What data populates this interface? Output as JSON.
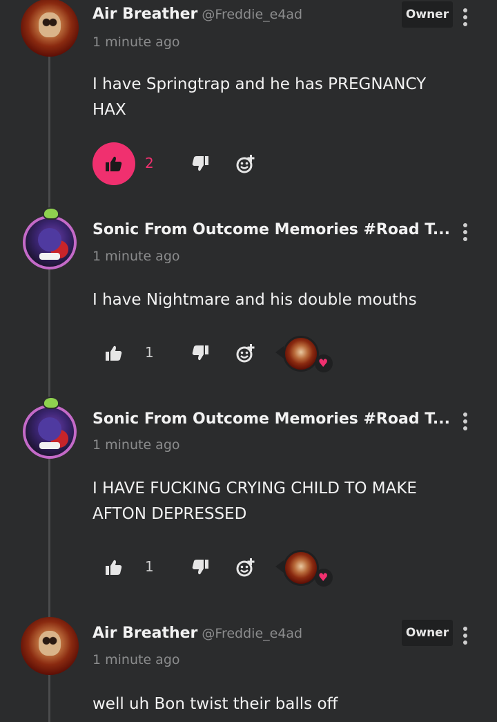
{
  "colors": {
    "background": "#2b2c2d",
    "accent": "#f0306f",
    "muted": "#8b8c8d"
  },
  "comments": [
    {
      "author": "Air Breather",
      "handle": "@Freddie_e4ad",
      "badge": "Owner",
      "time": "1 minute ago",
      "text": "I have Springtrap and he has PREGNANCY HAX",
      "likes": "2",
      "liked": true,
      "avatar": "skull-avatar"
    },
    {
      "author": "Sonic From Outcome Memories #Road T...",
      "time": "1 minute ago",
      "text": "I have Nightmare and his double mouths",
      "likes": "1",
      "liked": false,
      "avatar": "sonic-avatar",
      "reaction": "heart-icon"
    },
    {
      "author": "Sonic From Outcome Memories #Road T...",
      "time": "1 minute ago",
      "text": "I HAVE FUCKING CRYING CHILD TO MAKE AFTON DEPRESSED",
      "likes": "1",
      "liked": false,
      "avatar": "sonic-avatar",
      "reaction": "heart-icon"
    },
    {
      "author": "Air Breather",
      "handle": "@Freddie_e4ad",
      "badge": "Owner",
      "time": "1 minute ago",
      "text": "well uh Bon twist their balls off",
      "avatar": "skull-avatar"
    }
  ]
}
